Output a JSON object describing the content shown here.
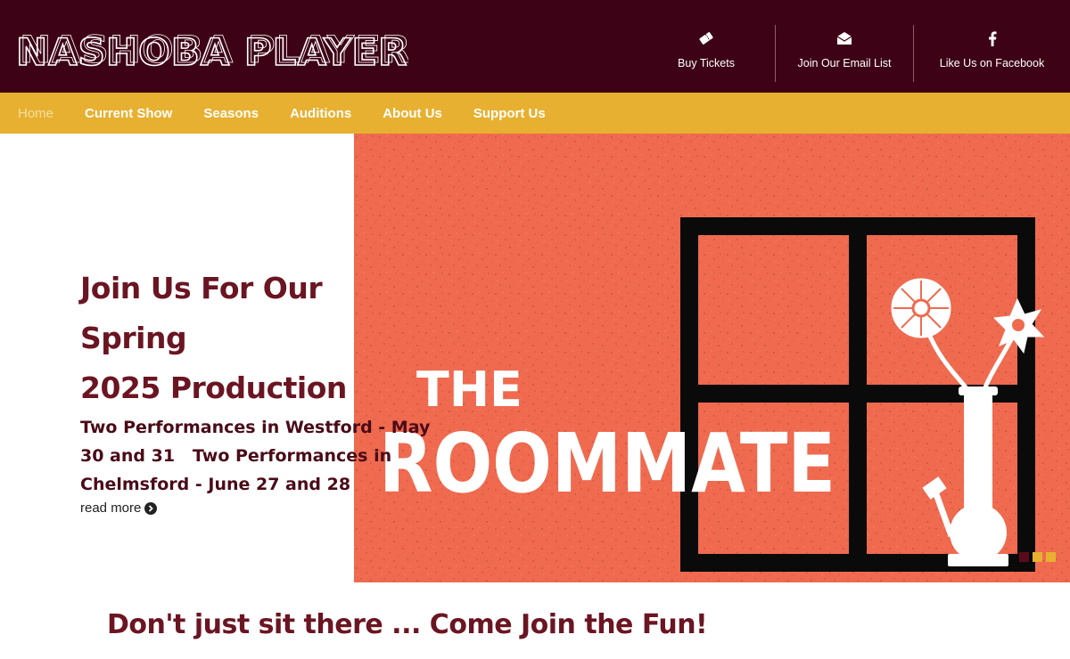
{
  "brand": {
    "name": "NASHOBA PLAYERS"
  },
  "header_links": [
    {
      "label": "Buy Tickets",
      "icon": "ticket-icon"
    },
    {
      "label": "Join Our Email List",
      "icon": "envelope-icon"
    },
    {
      "label": "Like Us on Facebook",
      "icon": "facebook-icon"
    }
  ],
  "nav": {
    "items": [
      "Home",
      "Current Show",
      "Seasons",
      "Auditions",
      "About Us",
      "Support Us"
    ],
    "active": "Home"
  },
  "hero": {
    "title_line1": "Join Us For Our Spring",
    "title_line2": "2025 Production",
    "subtitle": "Two Performances in Westford - May 30 and 31   Two Performances in Chelmsford - June 27 and 28",
    "read_more": "read more",
    "image": {
      "word1": "THE",
      "word2": "ROOMMATE"
    },
    "slides": {
      "total": 3,
      "active": 1
    }
  },
  "tagline": "Don't just sit there ... Come Join the Fun!",
  "colors": {
    "header_bg": "#3d0216",
    "nav_bg": "#e8b030",
    "brand_red": "#6b1522",
    "poster_bg": "#ef6a4f"
  }
}
